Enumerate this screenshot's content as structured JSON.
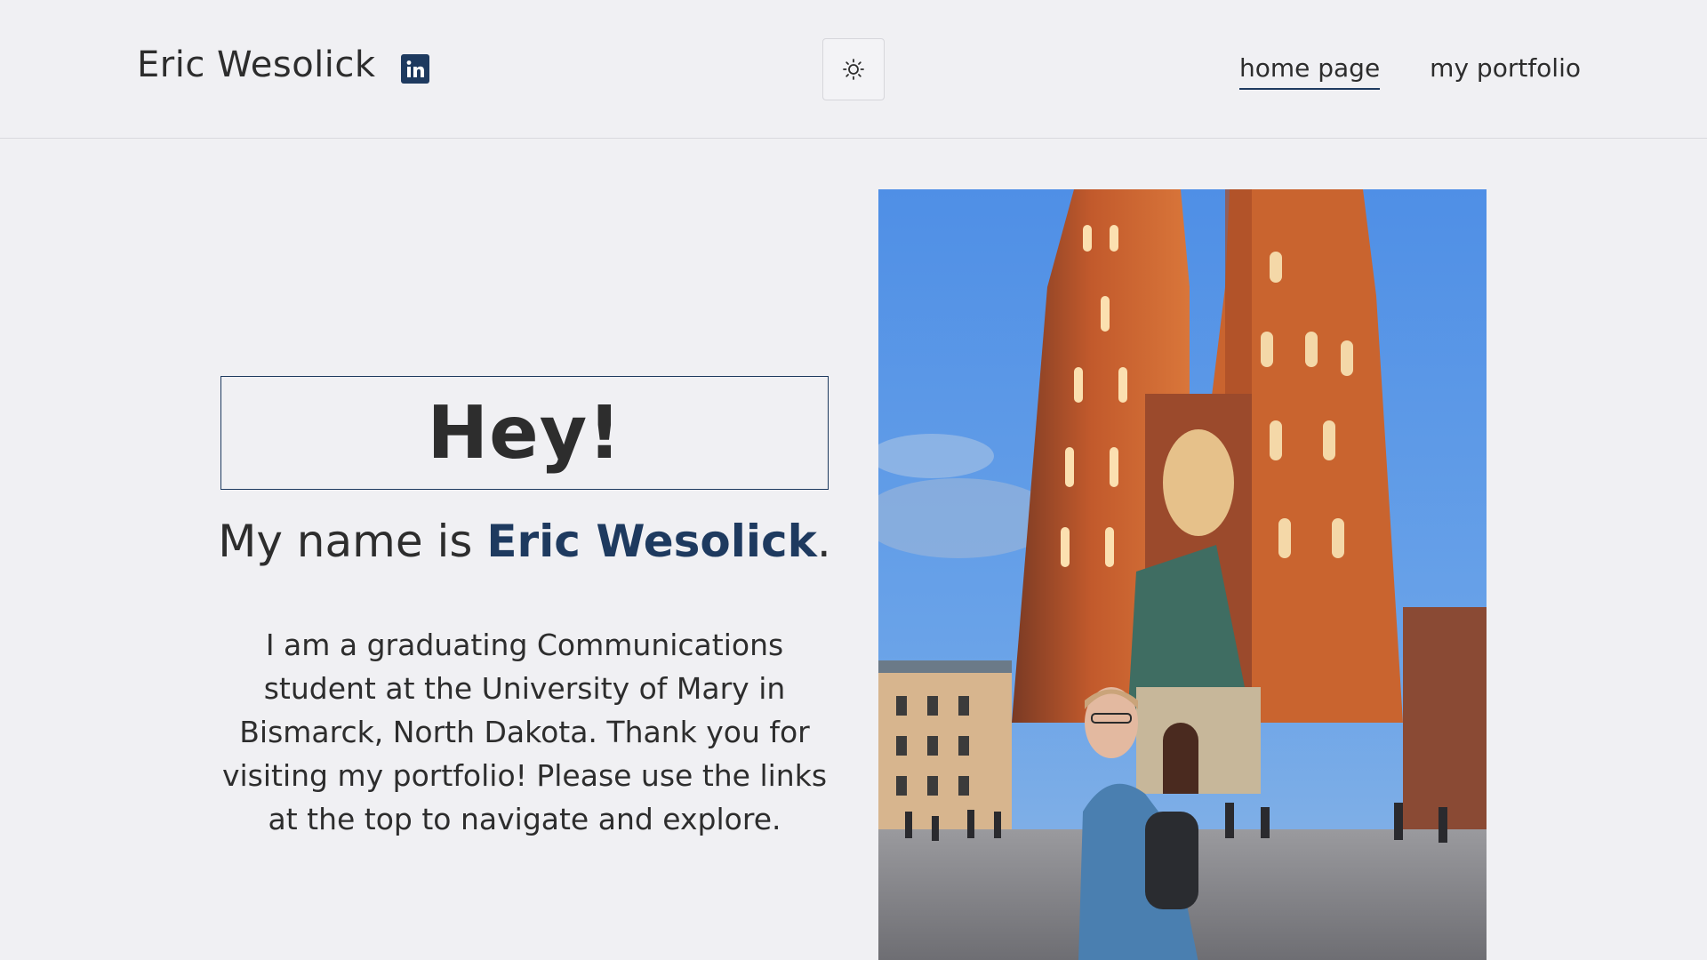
{
  "header": {
    "site_title": "Eric Wesolick",
    "linkedin_icon": "linkedin-icon",
    "theme_toggle_icon": "sun-icon",
    "nav": [
      {
        "label": "home page",
        "active": true
      },
      {
        "label": "my portfolio",
        "active": false
      }
    ]
  },
  "main": {
    "greeting": "Hey!",
    "intro_prefix": "My name is ",
    "intro_name": "Eric Wesolick",
    "intro_suffix": ".",
    "bio": "I am a graduating Communications student at the University of Mary in Bismarck, North Dakota. Thank you for visiting my portfolio! Please use the links at the top to navigate and explore."
  },
  "colors": {
    "background": "#f0f0f3",
    "accent": "#1e3a5f",
    "text": "#2d2d2d"
  }
}
